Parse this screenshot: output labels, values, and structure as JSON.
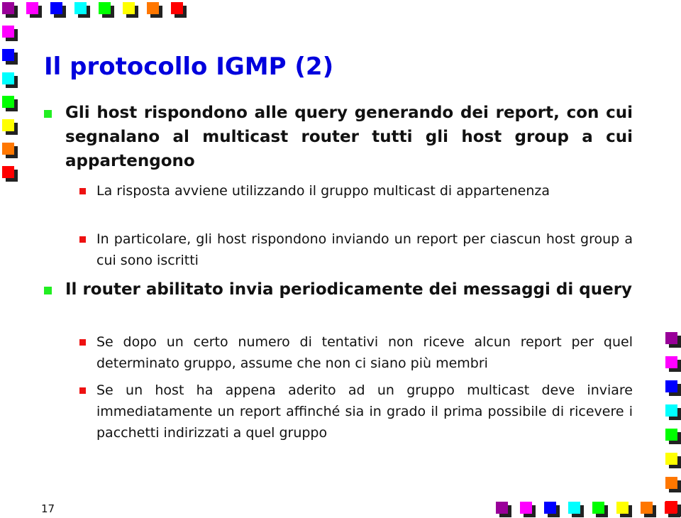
{
  "slide": {
    "title": "Il protocollo IGMP (2)",
    "page_number": "17",
    "bullets": [
      {
        "text": "Gli host rispondono alle query generando dei report, con cui segnalano al multicast router tutti gli host group a cui appartengono",
        "sub": [
          {
            "text": "La risposta avviene utilizzando il gruppo multicast di appartenenza"
          },
          {
            "text": "In particolare, gli host rispondono inviando un report per ciascun host group a cui sono iscritti"
          }
        ]
      },
      {
        "text": "Il router abilitato invia periodicamente dei messaggi di query",
        "sub": [
          {
            "text": "Se dopo un certo numero di tentativi non riceve alcun report per quel determinato gruppo, assume che non ci siano più membri"
          },
          {
            "text": "Se un host ha appena aderito ad un gruppo multicast deve inviare immediatamente un report affinché sia in grado il prima possibile di ricevere i pacchetti indirizzati a quel gruppo"
          }
        ]
      }
    ]
  },
  "colors": {
    "title": "#0000dd",
    "bullet_level1": "#22ee22",
    "bullet_level2": "#ee1111",
    "decor_squares": [
      "#990099",
      "#ff00ff",
      "#0000ff",
      "#00ffff",
      "#00ff00",
      "#ffff00",
      "#ff7700",
      "#ff0000"
    ]
  }
}
